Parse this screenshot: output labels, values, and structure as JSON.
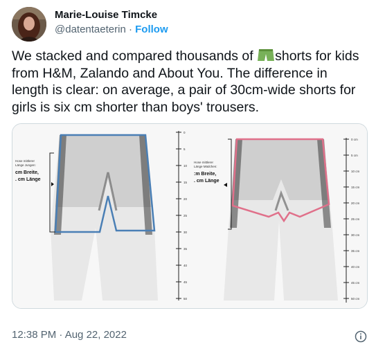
{
  "author": {
    "name": "Marie-Louise Timcke",
    "handle": "@datentaeterin",
    "separator": "·",
    "follow_label": "Follow"
  },
  "tweet": {
    "text_before_emoji": "We stacked and compared thousands of ",
    "emoji_name": "shorts-emoji",
    "text_after_emoji": "shorts for kids from H&M, Zalando and About You. The difference in length is clear: on average, a pair of 30cm-wide shorts for girls is six cm shorter than boys' trousers."
  },
  "media": {
    "left_panel": {
      "label_small_1": "Hose mittlerer",
      "label_small_2": "Länge Jungen:",
      "label_big_1": "cm Breite,",
      "label_big_2": ". cm Länge",
      "outline_color": "#4a7fb5",
      "ruler_ticks": [
        "0",
        "5",
        "10",
        "15",
        "20",
        "25",
        "30",
        "35",
        "40",
        "45",
        "50"
      ]
    },
    "right_panel": {
      "label_small_1": "Hose mittlerer",
      "label_small_2": "Länge Mädchen:",
      "label_big_1": ":m Breite,",
      "label_big_2": ". cm Länge",
      "outline_color": "#e0708a",
      "ruler_ticks": [
        "0 cm",
        "5 cm",
        "10 cm",
        "15 cm",
        "20 cm",
        "25 cm",
        "30 cm",
        "35 cm",
        "40 cm",
        "45 cm",
        "50 cm"
      ]
    }
  },
  "footer": {
    "timestamp": "12:38 PM · Aug 22, 2022",
    "info_icon": "info-icon"
  }
}
